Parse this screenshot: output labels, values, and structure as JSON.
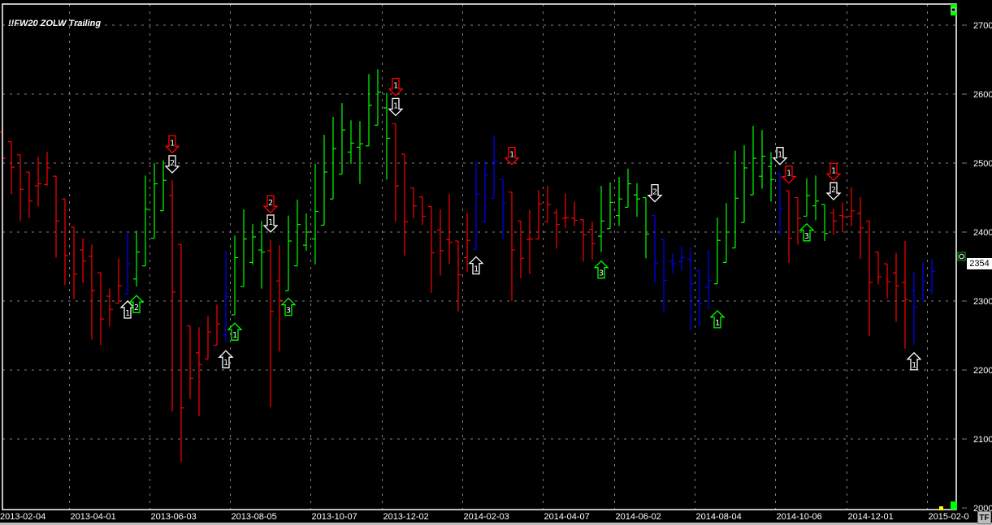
{
  "title": "!!FW20 ZOLW Trailing",
  "last_price_label": "2354",
  "tf_button": "TF",
  "colors": {
    "up": "#00ff00",
    "down": "#ff0000",
    "neutral": "#0000ff",
    "signal": "#ffffff",
    "grid": "#808080",
    "background": "#000000"
  },
  "chart_data": {
    "type": "ohlc",
    "title": "!!FW20 ZOLW Trailing",
    "interval": "weekly",
    "first_bar_date": "2013-02-04",
    "ylim": [
      2000,
      2700
    ],
    "y_ticks": [
      "2000",
      "2100",
      "2200",
      "2300",
      "2400",
      "2500",
      "2600",
      "2700"
    ],
    "x_ticks": [
      {
        "label": "2013-02-04",
        "index": 0
      },
      {
        "label": "2013-04-01",
        "index": 8
      },
      {
        "label": "2013-06-03",
        "index": 17
      },
      {
        "label": "2013-08-05",
        "index": 26
      },
      {
        "label": "2013-10-07",
        "index": 35
      },
      {
        "label": "2013-12-02",
        "index": 43
      },
      {
        "label": "2014-02-03",
        "index": 52
      },
      {
        "label": "2014-04-07",
        "index": 61
      },
      {
        "label": "2014-06-02",
        "index": 69
      },
      {
        "label": "2014-08-04",
        "index": 78
      },
      {
        "label": "2014-10-06",
        "index": 87
      },
      {
        "label": "2014-12-01",
        "index": 95
      },
      {
        "label": "2015-02-0",
        "index": 104
      }
    ],
    "grid": true,
    "bars_fields": [
      "open",
      "high",
      "low",
      "close",
      "color"
    ],
    "bars": [
      [
        2545,
        2554,
        2440,
        2507,
        "r"
      ],
      [
        2531,
        2531,
        2455,
        2494,
        "r"
      ],
      [
        2512,
        2512,
        2416,
        2462,
        "r"
      ],
      [
        2487,
        2487,
        2420,
        2445,
        "r"
      ],
      [
        2467,
        2509,
        2437,
        2470,
        "r"
      ],
      [
        2469,
        2516,
        2467,
        2493,
        "r"
      ],
      [
        2481,
        2481,
        2363,
        2416,
        "r"
      ],
      [
        2448,
        2448,
        2323,
        2366,
        "r"
      ],
      [
        2407,
        2407,
        2303,
        2339,
        "r"
      ],
      [
        2374,
        2391,
        2326,
        2358,
        "r"
      ],
      [
        2365,
        2382,
        2244,
        2315,
        "r"
      ],
      [
        2341,
        2341,
        2236,
        2274,
        "r"
      ],
      [
        2307,
        2318,
        2263,
        2288,
        "r"
      ],
      [
        2297,
        2362,
        2297,
        2322,
        "r"
      ],
      [
        2310,
        2400,
        2310,
        2354,
        "b"
      ],
      [
        2332,
        2402,
        2321,
        2371,
        "g"
      ],
      [
        2351,
        2482,
        2351,
        2433,
        "g"
      ],
      [
        2391,
        2500,
        2391,
        2470,
        "g"
      ],
      [
        2431,
        2504,
        2431,
        2475,
        "g"
      ],
      [
        2453,
        2475,
        2140,
        2313,
        "r"
      ],
      [
        2382,
        2382,
        2067,
        2145,
        "r"
      ],
      [
        2264,
        2264,
        2158,
        2188,
        "r"
      ],
      [
        2225,
        2262,
        2133,
        2208,
        "r"
      ],
      [
        2216,
        2278,
        2216,
        2255,
        "r"
      ],
      [
        2236,
        2295,
        2236,
        2267,
        "r"
      ],
      [
        2251,
        2373,
        2240,
        2306,
        "b"
      ],
      [
        2280,
        2395,
        2280,
        2363,
        "g"
      ],
      [
        2321,
        2433,
        2321,
        2390,
        "g"
      ],
      [
        2356,
        2412,
        2353,
        2393,
        "g"
      ],
      [
        2374,
        2416,
        2318,
        2371,
        "g"
      ],
      [
        2373,
        2389,
        2146,
        2285,
        "r"
      ],
      [
        2329,
        2381,
        2227,
        2301,
        "r"
      ],
      [
        2315,
        2424,
        2315,
        2387,
        "g"
      ],
      [
        2351,
        2447,
        2351,
        2411,
        "g"
      ],
      [
        2381,
        2427,
        2373,
        2400,
        "g"
      ],
      [
        2390,
        2499,
        2353,
        2430,
        "g"
      ],
      [
        2410,
        2541,
        2410,
        2487,
        "g"
      ],
      [
        2448,
        2567,
        2448,
        2521,
        "g"
      ],
      [
        2484,
        2587,
        2484,
        2548,
        "g"
      ],
      [
        2516,
        2562,
        2499,
        2529,
        "g"
      ],
      [
        2523,
        2561,
        2470,
        2528,
        "g"
      ],
      [
        2525,
        2629,
        2525,
        2584,
        "g"
      ],
      [
        2555,
        2636,
        2555,
        2603,
        "g"
      ],
      [
        2580,
        2602,
        2476,
        2536,
        "g"
      ],
      [
        2557,
        2557,
        2415,
        2467,
        "r"
      ],
      [
        2513,
        2513,
        2366,
        2415,
        "r"
      ],
      [
        2464,
        2464,
        2420,
        2438,
        "r"
      ],
      [
        2451,
        2451,
        2410,
        2423,
        "r"
      ],
      [
        2437,
        2437,
        2312,
        2370,
        "r"
      ],
      [
        2403,
        2433,
        2337,
        2373,
        "r"
      ],
      [
        2389,
        2455,
        2354,
        2385,
        "r"
      ],
      [
        2387,
        2387,
        2285,
        2338,
        "r"
      ],
      [
        2363,
        2428,
        2342,
        2388,
        "r"
      ],
      [
        2375,
        2503,
        2375,
        2455,
        "b"
      ],
      [
        2415,
        2502,
        2415,
        2483,
        "b"
      ],
      [
        2449,
        2540,
        2449,
        2503,
        "b"
      ],
      [
        2476,
        2476,
        2390,
        2442,
        "b"
      ],
      [
        2458,
        2458,
        2300,
        2374,
        "r"
      ],
      [
        2416,
        2416,
        2333,
        2362,
        "r"
      ],
      [
        2389,
        2432,
        2339,
        2390,
        "r"
      ],
      [
        2390,
        2461,
        2390,
        2441,
        "r"
      ],
      [
        2415,
        2467,
        2415,
        2440,
        "r"
      ],
      [
        2428,
        2433,
        2376,
        2411,
        "r"
      ],
      [
        2420,
        2456,
        2406,
        2421,
        "r"
      ],
      [
        2420,
        2444,
        2409,
        2417,
        "r"
      ],
      [
        2418,
        2418,
        2357,
        2396,
        "r"
      ],
      [
        2404,
        2415,
        2360,
        2383,
        "r"
      ],
      [
        2394,
        2467,
        2371,
        2416,
        "g"
      ],
      [
        2405,
        2472,
        2405,
        2443,
        "g"
      ],
      [
        2424,
        2480,
        2409,
        2448,
        "g"
      ],
      [
        2436,
        2492,
        2436,
        2470,
        "g"
      ],
      [
        2454,
        2471,
        2422,
        2448,
        "g"
      ],
      [
        2450,
        2450,
        2362,
        2397,
        "g"
      ],
      [
        2424,
        2424,
        2326,
        2355,
        "b"
      ],
      [
        2389,
        2389,
        2283,
        2330,
        "b"
      ],
      [
        2358,
        2369,
        2340,
        2354,
        "b"
      ],
      [
        2357,
        2379,
        2344,
        2363,
        "b"
      ],
      [
        2360,
        2377,
        2257,
        2325,
        "b"
      ],
      [
        2344,
        2344,
        2263,
        2296,
        "b"
      ],
      [
        2320,
        2374,
        2288,
        2330,
        "b"
      ],
      [
        2325,
        2421,
        2325,
        2388,
        "g"
      ],
      [
        2356,
        2442,
        2356,
        2400,
        "g"
      ],
      [
        2377,
        2518,
        2377,
        2449,
        "g"
      ],
      [
        2414,
        2526,
        2414,
        2493,
        "g"
      ],
      [
        2454,
        2554,
        2454,
        2507,
        "g"
      ],
      [
        2481,
        2548,
        2463,
        2510,
        "g"
      ],
      [
        2495,
        2516,
        2444,
        2476,
        "g"
      ],
      [
        2485,
        2485,
        2395,
        2434,
        "b"
      ],
      [
        2460,
        2460,
        2355,
        2391,
        "r"
      ],
      [
        2450,
        2450,
        2382,
        2420,
        "r"
      ],
      [
        2423,
        2478,
        2423,
        2453,
        "g"
      ],
      [
        2438,
        2482,
        2417,
        2445,
        "g"
      ],
      [
        2440,
        2440,
        2387,
        2398,
        "g"
      ],
      [
        2428,
        2434,
        2396,
        2416,
        "r"
      ],
      [
        2424,
        2443,
        2400,
        2422,
        "r"
      ],
      [
        2423,
        2465,
        2408,
        2431,
        "r"
      ],
      [
        2427,
        2451,
        2361,
        2406,
        "r"
      ],
      [
        2416,
        2416,
        2249,
        2327,
        "r"
      ],
      [
        2371,
        2371,
        2324,
        2335,
        "r"
      ],
      [
        2354,
        2354,
        2304,
        2328,
        "r"
      ],
      [
        2341,
        2370,
        2270,
        2322,
        "r"
      ],
      [
        2327,
        2387,
        2231,
        2302,
        "r"
      ],
      [
        2315,
        2342,
        2236,
        2291,
        "b"
      ],
      [
        2303,
        2356,
        2300,
        2329,
        "b"
      ],
      [
        2316,
        2361,
        2309,
        2343,
        "b"
      ]
    ],
    "signals": [
      {
        "index": 14,
        "dir": "up",
        "color": "white",
        "label": "1",
        "price": 2300
      },
      {
        "index": 15,
        "dir": "up",
        "color": "green",
        "label": "2",
        "price": 2308
      },
      {
        "index": 19,
        "dir": "down",
        "color": "red",
        "label": "1",
        "price": 2515
      },
      {
        "index": 19,
        "dir": "down",
        "color": "white",
        "label": "2",
        "price": 2486
      },
      {
        "index": 25,
        "dir": "up",
        "color": "white",
        "label": "1",
        "price": 2228
      },
      {
        "index": 26,
        "dir": "up",
        "color": "green",
        "label": "1",
        "price": 2268
      },
      {
        "index": 30,
        "dir": "down",
        "color": "red",
        "label": "2",
        "price": 2428
      },
      {
        "index": 30,
        "dir": "down",
        "color": "white",
        "label": "1",
        "price": 2400
      },
      {
        "index": 32,
        "dir": "up",
        "color": "green",
        "label": "3",
        "price": 2304
      },
      {
        "index": 44,
        "dir": "down",
        "color": "red",
        "label": "1",
        "price": 2598
      },
      {
        "index": 44,
        "dir": "down",
        "color": "white",
        "label": "1",
        "price": 2569
      },
      {
        "index": 53,
        "dir": "up",
        "color": "white",
        "label": "1",
        "price": 2364
      },
      {
        "index": 57,
        "dir": "down",
        "color": "red",
        "label": "1",
        "price": 2498
      },
      {
        "index": 67,
        "dir": "up",
        "color": "green",
        "label": "3",
        "price": 2358
      },
      {
        "index": 73,
        "dir": "down",
        "color": "white",
        "label": "2",
        "price": 2444
      },
      {
        "index": 80,
        "dir": "up",
        "color": "green",
        "label": "1",
        "price": 2286
      },
      {
        "index": 87,
        "dir": "down",
        "color": "white",
        "label": "1",
        "price": 2498
      },
      {
        "index": 88,
        "dir": "down",
        "color": "red",
        "label": "1",
        "price": 2471
      },
      {
        "index": 90,
        "dir": "up",
        "color": "green",
        "label": "3",
        "price": 2412
      },
      {
        "index": 93,
        "dir": "down",
        "color": "red",
        "label": "1",
        "price": 2475
      },
      {
        "index": 93,
        "dir": "down",
        "color": "white",
        "label": "2",
        "price": 2447
      },
      {
        "index": 102,
        "dir": "up",
        "color": "white",
        "label": "1",
        "price": 2225
      }
    ],
    "last_price": 2354
  }
}
